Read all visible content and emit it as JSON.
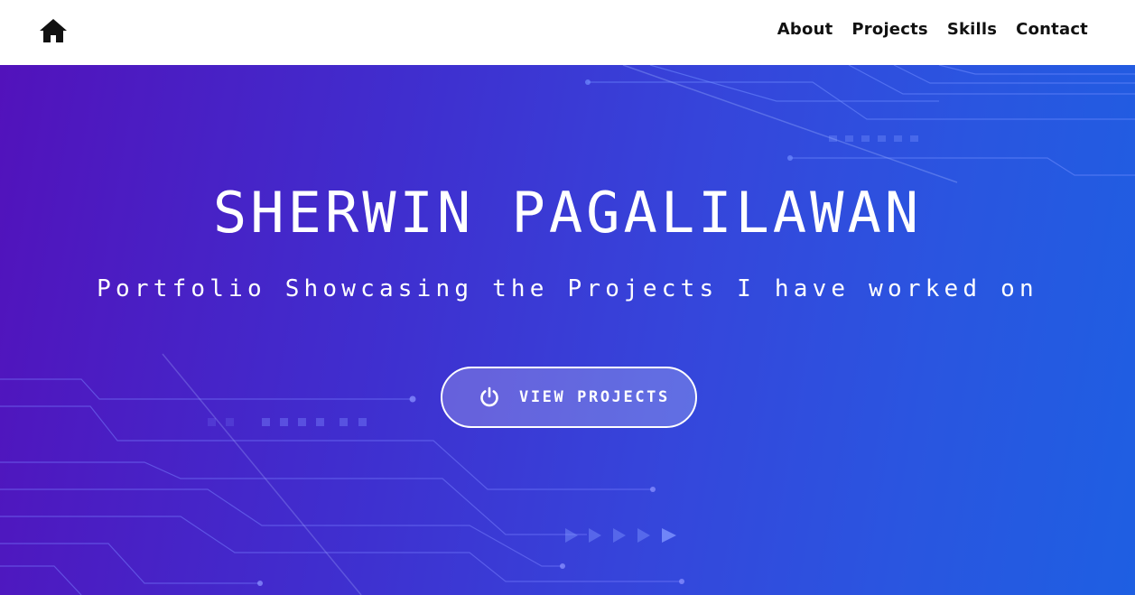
{
  "nav": {
    "home_icon": "home-icon",
    "links": [
      "About",
      "Projects",
      "Skills",
      "Contact"
    ]
  },
  "hero": {
    "title": "SHERWIN PAGALILAWAN",
    "subtitle": "Portfolio Showcasing the Projects I have worked on",
    "cta": {
      "label": "VIEW PROJECTS",
      "icon": "power-icon"
    }
  },
  "colors": {
    "gradient_start": "#5212bb",
    "gradient_end": "#1e5fe2",
    "nav_background": "#ffffff",
    "nav_text": "#111111",
    "hero_text": "#ffffff"
  }
}
